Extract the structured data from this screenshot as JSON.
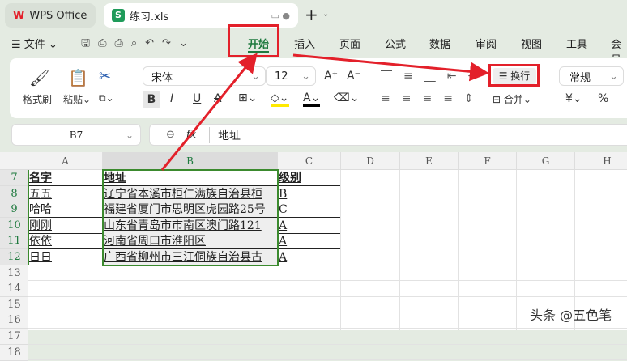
{
  "app": {
    "name": "WPS Office",
    "file_tab": "练习.xls"
  },
  "menu": {
    "file": "文件",
    "tabs": [
      "开始",
      "插入",
      "页面",
      "公式",
      "数据",
      "审阅",
      "视图",
      "工具",
      "会员"
    ]
  },
  "ribbon": {
    "format_painter": "格式刷",
    "paste": "粘贴",
    "font": "宋体",
    "font_size": "12",
    "bold": "B",
    "italic": "I",
    "underline": "U",
    "wrap": "换行",
    "merge": "合并",
    "number_format": "常规",
    "currency": "¥",
    "percent": "%"
  },
  "formula": {
    "cell_ref": "B7",
    "fx": "fx",
    "value": "地址"
  },
  "columns": [
    "A",
    "B",
    "C",
    "D",
    "E",
    "F",
    "G",
    "H"
  ],
  "rows": [
    {
      "n": "7",
      "a": "名字",
      "b": "地址",
      "c": "级别"
    },
    {
      "n": "8",
      "a": "五五",
      "b": "辽宁省本溪市桓仁满族自治县桓",
      "c": "B"
    },
    {
      "n": "9",
      "a": "哈哈",
      "b": "福建省厦门市思明区虎园路25号",
      "c": "C"
    },
    {
      "n": "10",
      "a": "刚刚",
      "b": "山东省青岛市市南区澳门路121",
      "c": "A"
    },
    {
      "n": "11",
      "a": "依依",
      "b": "河南省周口市淮阳区",
      "c": "A"
    },
    {
      "n": "12",
      "a": "日日",
      "b": "广西省柳州市三江侗族自治县古",
      "c": "A"
    }
  ],
  "empty_rows": [
    "13",
    "14",
    "15",
    "16",
    "17",
    "18"
  ],
  "watermark": "头条 @五色笔",
  "colors": {
    "accent": "#1f7a3f",
    "annotation": "#e3202a"
  }
}
